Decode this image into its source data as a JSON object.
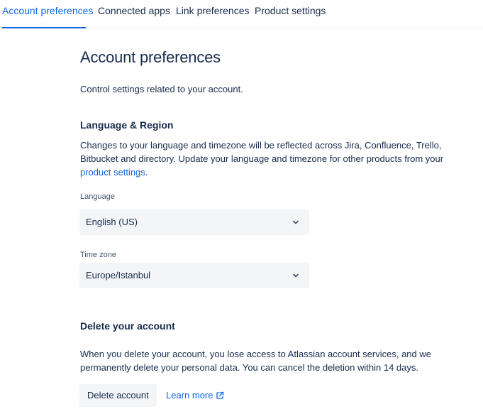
{
  "tabs": [
    {
      "label": "Account preferences",
      "active": true
    },
    {
      "label": "Connected apps",
      "active": false
    },
    {
      "label": "Link preferences",
      "active": false
    },
    {
      "label": "Product settings",
      "active": false
    }
  ],
  "page": {
    "title": "Account preferences",
    "intro": "Control settings related to your account."
  },
  "language_region": {
    "heading": "Language & Region",
    "description_prefix": "Changes to your language and timezone will be reflected across Jira, Confluence, Trello, Bitbucket and directory. Update your language and timezone for other products from your ",
    "description_link": "product settings",
    "description_suffix": ".",
    "language_label": "Language",
    "language_value": "English (US)",
    "timezone_label": "Time zone",
    "timezone_value": "Europe/Istanbul"
  },
  "delete_account": {
    "heading": "Delete your account",
    "description": "When you delete your account, you lose access to Atlassian account services, and we permanently delete your personal data. You can cancel the deletion within 14 days.",
    "delete_button": "Delete account",
    "learn_more": "Learn more"
  },
  "icons": {
    "chevron": "chevron-down-icon",
    "external": "external-link-icon"
  },
  "colors": {
    "accent": "#0c66e4",
    "text": "#172b4d",
    "field_bg": "#f4f5f7"
  }
}
